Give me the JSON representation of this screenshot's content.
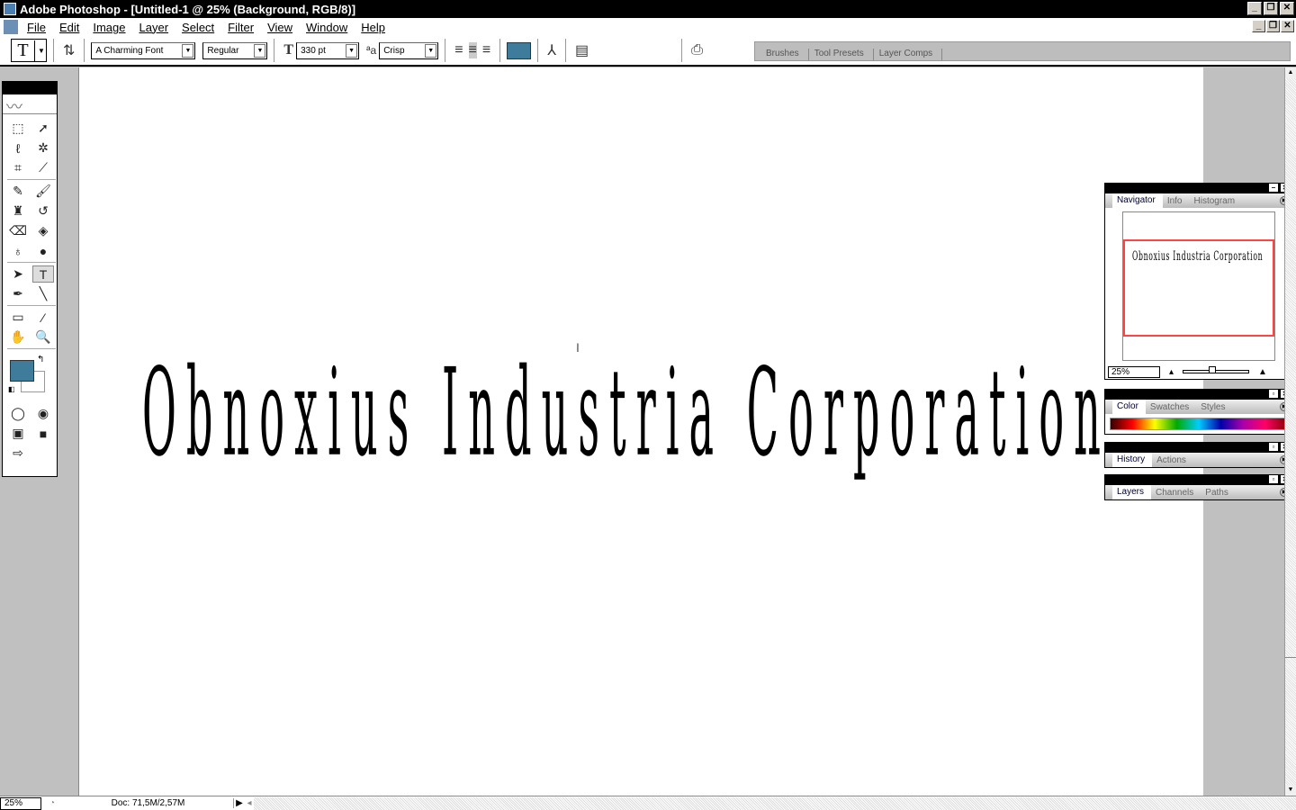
{
  "window": {
    "title": "Adobe Photoshop - [Untitled-1 @ 25% (Background, RGB/8)]"
  },
  "menu": [
    "File",
    "Edit",
    "Image",
    "Layer",
    "Select",
    "Filter",
    "View",
    "Window",
    "Help"
  ],
  "options": {
    "tool": "T",
    "font_family": "A Charming Font",
    "font_style": "Regular",
    "font_size": "330 pt",
    "antialias": "Crisp",
    "text_color": "#3f7c9b"
  },
  "well_tabs": [
    "Brushes",
    "Tool Presets",
    "Layer Comps"
  ],
  "canvas": {
    "text": "Obnoxius Industria Corporation"
  },
  "panels": {
    "navigator": {
      "tabs": [
        "Navigator",
        "Info",
        "Histogram"
      ],
      "zoom": "25%",
      "thumb_text": "Obnoxius Industria Corporation"
    },
    "color": {
      "tabs": [
        "Color",
        "Swatches",
        "Styles"
      ]
    },
    "history": {
      "tabs": [
        "History",
        "Actions"
      ]
    },
    "layers": {
      "tabs": [
        "Layers",
        "Channels",
        "Paths"
      ]
    }
  },
  "status": {
    "zoom": "25%",
    "doc": "Doc: 71,5M/2,57M"
  },
  "colors": {
    "foreground": "#3f7c9b",
    "background": "#ffffff"
  }
}
